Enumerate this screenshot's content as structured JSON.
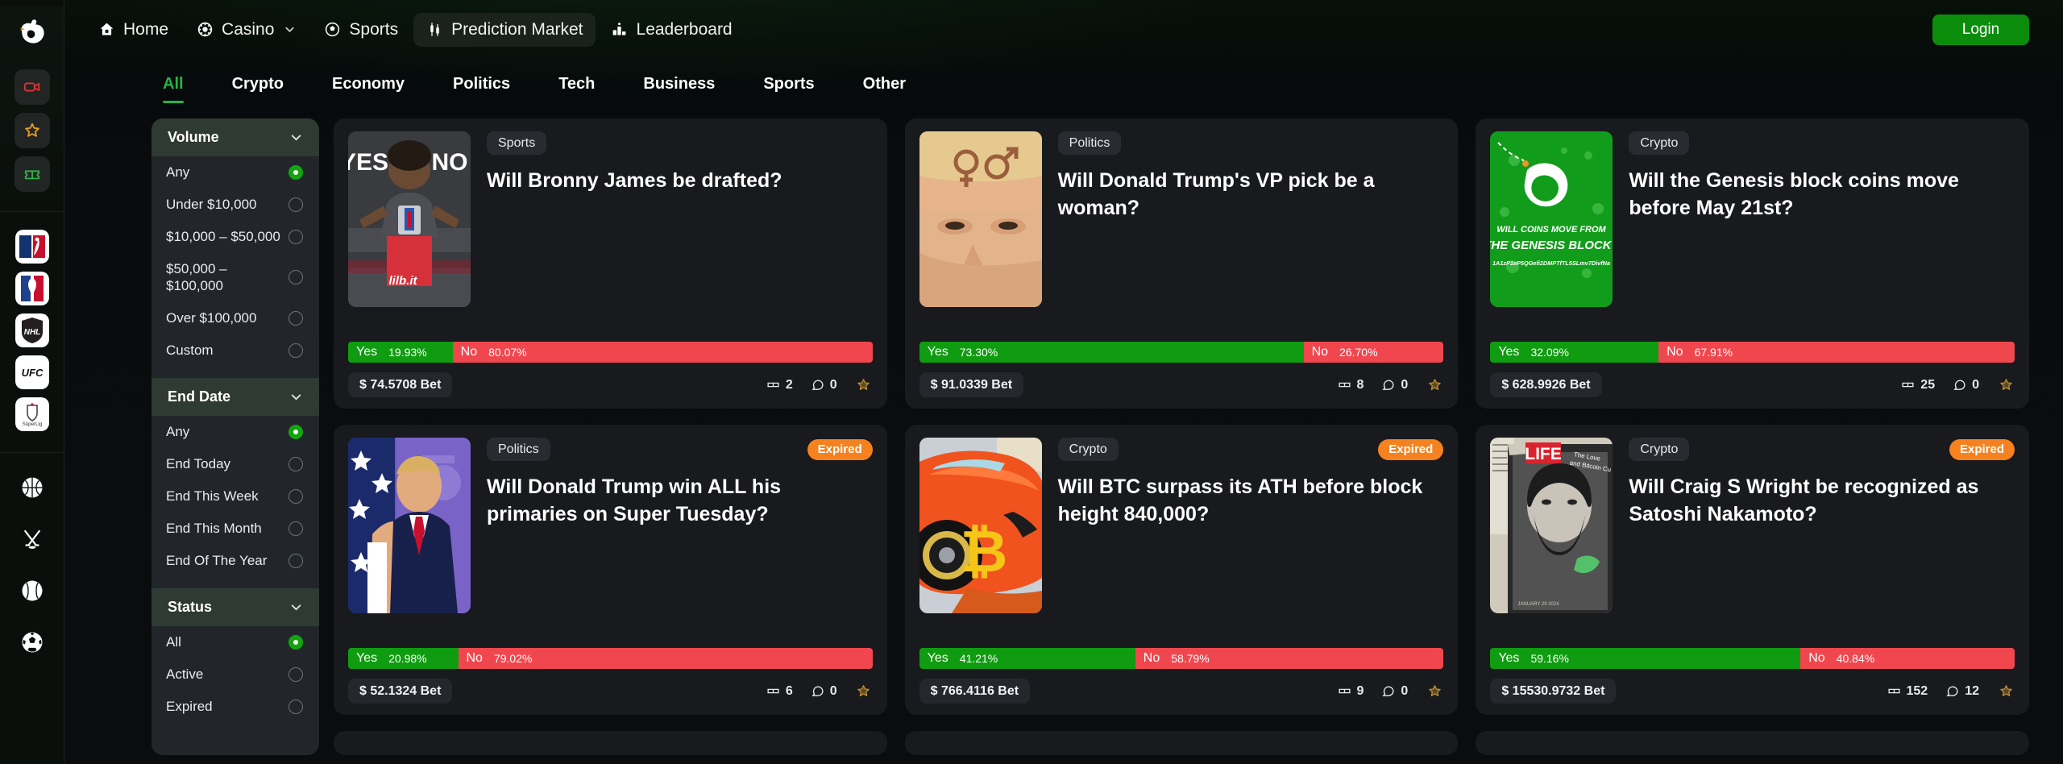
{
  "brand": {
    "logo_icon": "fist-logo-icon"
  },
  "rail": {
    "quick_buttons": [
      {
        "name": "live-video-icon",
        "color": "#e03131"
      },
      {
        "name": "favorites-star-icon",
        "color": "#e8a020"
      },
      {
        "name": "promo-ticket-icon",
        "color": "#2fb344"
      }
    ],
    "leagues": [
      {
        "name": "mlb-logo-icon",
        "label": "MLB"
      },
      {
        "name": "nba-logo-icon",
        "label": "NBA"
      },
      {
        "name": "nhl-logo-icon",
        "label": "NHL"
      },
      {
        "name": "ufc-logo-icon",
        "label": "UFC"
      },
      {
        "name": "superlig-logo-icon",
        "label": "SüperLig"
      }
    ],
    "sports": [
      {
        "name": "basketball-icon"
      },
      {
        "name": "ice-hockey-icon"
      },
      {
        "name": "baseball-icon"
      },
      {
        "name": "soccer-icon"
      }
    ]
  },
  "topbar": {
    "nav": [
      {
        "label": "Home",
        "icon": "home-icon",
        "active": false,
        "caret": false
      },
      {
        "label": "Casino",
        "icon": "casino-chip-icon",
        "active": false,
        "caret": true
      },
      {
        "label": "Sports",
        "icon": "soccer-ball-icon",
        "active": false,
        "caret": false
      },
      {
        "label": "Prediction Market",
        "icon": "candlestick-icon",
        "active": true,
        "caret": false
      },
      {
        "label": "Leaderboard",
        "icon": "podium-icon",
        "active": false,
        "caret": false
      }
    ],
    "login_label": "Login",
    "login_color": "#0b8d0b"
  },
  "categories": {
    "active": "All",
    "items": [
      "All",
      "Crypto",
      "Economy",
      "Politics",
      "Tech",
      "Business",
      "Sports",
      "Other"
    ],
    "accent": "#22b544"
  },
  "filters": [
    {
      "title": "Volume",
      "options": [
        {
          "label": "Any",
          "selected": true
        },
        {
          "label": "Under $10,000",
          "selected": false
        },
        {
          "label": "$10,000 – $50,000",
          "selected": false
        },
        {
          "label": "$50,000 – $100,000",
          "selected": false
        },
        {
          "label": "Over $100,000",
          "selected": false
        },
        {
          "label": "Custom",
          "selected": false
        }
      ]
    },
    {
      "title": "End Date",
      "options": [
        {
          "label": "Any",
          "selected": true
        },
        {
          "label": "End Today",
          "selected": false
        },
        {
          "label": "End This Week",
          "selected": false
        },
        {
          "label": "End This Month",
          "selected": false
        },
        {
          "label": "End Of The Year",
          "selected": false
        }
      ]
    },
    {
      "title": "Status",
      "options": [
        {
          "label": "All",
          "selected": true
        },
        {
          "label": "Active",
          "selected": false
        },
        {
          "label": "Expired",
          "selected": false
        }
      ]
    }
  ],
  "labels": {
    "yes": "Yes",
    "no": "No",
    "expired": "Expired",
    "bet_suffix": "Bet",
    "currency": "$"
  },
  "cards": [
    {
      "tag": "Sports",
      "expired": false,
      "title": "Will Bronny James be drafted?",
      "yes_pct": "19.93%",
      "no_pct": "80.07%",
      "yes_value": 19.93,
      "bet": "$ 74.5708 Bet",
      "bets_count": "2",
      "comments_count": "0",
      "thumb": "bronny-james-photo"
    },
    {
      "tag": "Politics",
      "expired": false,
      "title": "Will Donald Trump's VP pick be a woman?",
      "yes_pct": "73.30%",
      "no_pct": "26.70%",
      "yes_value": 73.3,
      "bet": "$ 91.0339 Bet",
      "bets_count": "8",
      "comments_count": "0",
      "thumb": "trump-face-photo"
    },
    {
      "tag": "Crypto",
      "expired": false,
      "title": "Will the Genesis block coins move before May 21st?",
      "yes_pct": "32.09%",
      "no_pct": "67.91%",
      "yes_value": 32.09,
      "bet": "$ 628.9926 Bet",
      "bets_count": "25",
      "comments_count": "0",
      "thumb": "genesis-block-graphic",
      "thumb_caption_1": "WILL COINS MOVE FROM",
      "thumb_caption_2": "THE GENESIS BLOCK?",
      "thumb_caption_3": "1A1zP1eP5QGefi2DMPTfTL5SLmv7DivfNa"
    },
    {
      "tag": "Politics",
      "expired": true,
      "title": "Will Donald Trump win ALL his primaries on Super Tuesday?",
      "yes_pct": "20.98%",
      "no_pct": "79.02%",
      "yes_value": 20.98,
      "bet": "$ 52.1324 Bet",
      "bets_count": "6",
      "comments_count": "0",
      "thumb": "trump-flag-photo"
    },
    {
      "tag": "Crypto",
      "expired": true,
      "title": "Will BTC surpass its ATH before block height 840,000?",
      "yes_pct": "41.21%",
      "no_pct": "58.79%",
      "yes_value": 41.21,
      "bet": "$ 766.4116 Bet",
      "bets_count": "9",
      "comments_count": "0",
      "thumb": "bitcoin-lambo-photo"
    },
    {
      "tag": "Crypto",
      "expired": true,
      "title": "Will Craig S Wright be recognized as Satoshi Nakamoto?",
      "yes_pct": "59.16%",
      "no_pct": "40.84%",
      "yes_value": 59.16,
      "bet": "$ 15530.9732 Bet",
      "bets_count": "152",
      "comments_count": "12",
      "thumb": "craig-wright-life-magazine-photo"
    }
  ]
}
